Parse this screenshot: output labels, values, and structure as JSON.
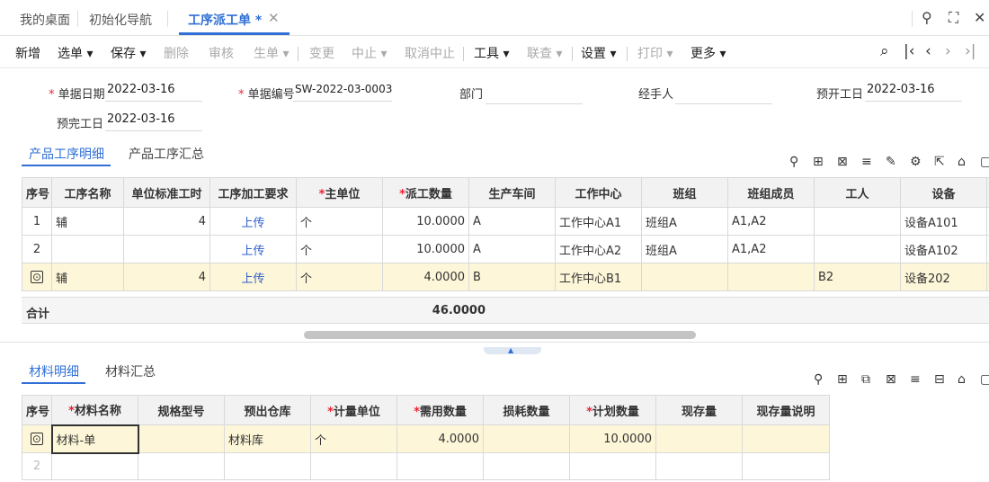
{
  "tabs": [
    {
      "label": "我的桌面"
    },
    {
      "label": "初始化导航"
    },
    {
      "label": "工序派工单 *"
    }
  ],
  "toolbar": {
    "buttons": [
      "新增",
      "选单 ▾",
      "保存 ▾",
      "删除",
      "审核",
      "生单 ▾",
      "变更",
      "中止 ▾",
      "取消中止",
      "工具 ▾",
      "联查 ▾",
      "设置 ▾",
      "打印 ▾",
      "更多 ▾"
    ]
  },
  "form": {
    "date_label": "单据日期",
    "date_value": "2022-03-16",
    "no_label": "单据编号",
    "no_value": "SW-2022-03-0003",
    "dept_label": "部门",
    "dept_value": "",
    "handler_label": "经手人",
    "handler_value": "",
    "start_label": "预开工日",
    "start_value": "2022-03-16",
    "finish_label": "预完工日",
    "finish_value": "2022-03-16"
  },
  "process_tabs": [
    "产品工序明细",
    "产品工序汇总"
  ],
  "process_table": {
    "columns": [
      "序号",
      "工序名称",
      "单位标准工时",
      "工序加工要求",
      "主单位",
      "派工数量",
      "生产车间",
      "工作中心",
      "班组",
      "班组成员",
      "工人",
      "设备"
    ],
    "rows": [
      [
        "1",
        "辅",
        "4",
        "上传",
        "个",
        "10.0000",
        "A",
        "工作中心A1",
        "班组A",
        "A1,A2",
        "",
        "设备A101"
      ],
      [
        "2",
        "",
        "",
        "上传",
        "个",
        "10.0000",
        "A",
        "工作中心A2",
        "班组A",
        "A1,A2",
        "",
        "设备A102"
      ],
      [
        "",
        "辅",
        "4",
        "上传",
        "个",
        "4.0000",
        "B",
        "工作中心B1",
        "",
        "",
        "B2",
        "设备202"
      ]
    ],
    "total_label": "合计",
    "total_value": "46.0000"
  },
  "material_tabs": [
    "材料明细",
    "材料汇总"
  ],
  "material_table": {
    "columns": [
      "序号",
      "材料名称",
      "规格型号",
      "预出仓库",
      "计量单位",
      "需用数量",
      "损耗数量",
      "计划数量",
      "现存量",
      "现存量说明"
    ],
    "rows": [
      [
        "",
        "材料-单",
        "",
        "材料库",
        "个",
        "4.0000",
        "",
        "10.0000",
        "",
        ""
      ],
      [
        "2",
        "",
        "",
        "",
        "",
        "",
        "",
        "",
        "",
        ""
      ]
    ]
  },
  "icons": {
    "search": "search-icon",
    "fullscreen": "fullscreen-icon",
    "close": "close-icon"
  }
}
